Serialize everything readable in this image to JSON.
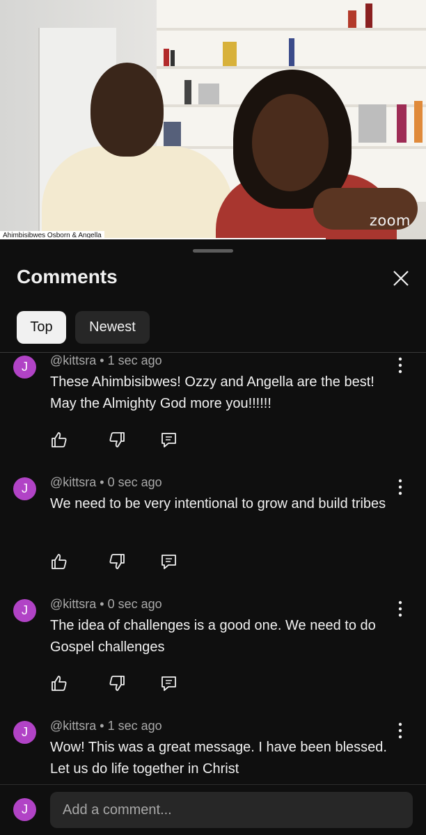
{
  "video": {
    "speaker_label": "Ahimbisibwes Osborn & Angella",
    "watermark": "zoom",
    "progress_fraction": 0.765
  },
  "panel": {
    "title": "Comments",
    "close_icon": "close-icon",
    "tabs": [
      {
        "label": "Top",
        "selected": true
      },
      {
        "label": "Newest",
        "selected": false
      }
    ]
  },
  "comments": [
    {
      "avatar": "J",
      "author": "@kittsra",
      "time": "1 sec ago",
      "meta": "@kittsra • 1 sec ago",
      "text": "These Ahimbisibwes! Ozzy and Angella are the best! May the Almighty God more you!!!!!!"
    },
    {
      "avatar": "J",
      "author": "@kittsra",
      "time": "0 sec ago",
      "meta": "@kittsra • 0 sec ago",
      "text": "We need to be very intentional to grow and build tribes"
    },
    {
      "avatar": "J",
      "author": "@kittsra",
      "time": "0 sec ago",
      "meta": "@kittsra • 0 sec ago",
      "text": "The idea of challenges is a good one. We need to do Gospel challenges"
    },
    {
      "avatar": "J",
      "author": "@kittsra",
      "time": "1 sec ago",
      "meta": "@kittsra • 1 sec ago",
      "text": "Wow! This was a great message.  I have been blessed. Let us do life together in Christ"
    }
  ],
  "composer": {
    "avatar": "J",
    "placeholder": "Add a comment..."
  },
  "colors": {
    "background": "#0f0f0f",
    "avatar": "#b143c6",
    "chip_selected": "#f1f1f1",
    "chip_default": "#272727"
  }
}
